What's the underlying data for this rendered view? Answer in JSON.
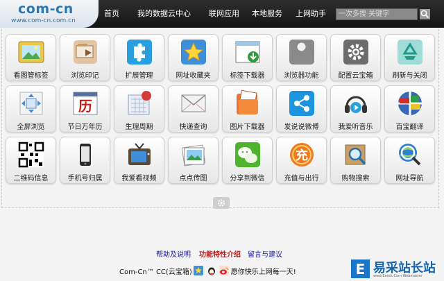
{
  "header": {
    "logo_main": "com-cn",
    "logo_sub": "www.com-cn.com.cn",
    "nav": [
      {
        "label": "首页",
        "name": "nav-home"
      },
      {
        "label": "我的数据云中心",
        "name": "nav-my-cloud-data"
      },
      {
        "label": "联网应用",
        "name": "nav-online-apps"
      },
      {
        "label": "本地服务",
        "name": "nav-local-services"
      },
      {
        "label": "上网助手",
        "name": "nav-web-assistant"
      }
    ],
    "search_placeholder": "一次多搜 关键字"
  },
  "tiles": [
    {
      "label": "看图管标签",
      "icon": "image-viewer-icon",
      "name": "tile-image-tag-manager"
    },
    {
      "label": "浏览印记",
      "icon": "browsing-history-icon",
      "name": "tile-browsing-footprint"
    },
    {
      "label": "扩展管理",
      "icon": "puzzle-extension-icon",
      "name": "tile-extension-manager"
    },
    {
      "label": "网址收藏夹",
      "icon": "star-favorites-icon",
      "name": "tile-url-favorites"
    },
    {
      "label": "标签下载器",
      "icon": "tab-download-icon",
      "name": "tile-tab-downloader"
    },
    {
      "label": "浏览器功能",
      "icon": "wrench-icon",
      "name": "tile-browser-features"
    },
    {
      "label": "配置云宝箱",
      "icon": "gear-icon",
      "name": "tile-configure-cloud-box"
    },
    {
      "label": "刷新与关闭",
      "icon": "recycle-refresh-icon",
      "name": "tile-refresh-close"
    },
    {
      "label": "全屏浏览",
      "icon": "fullscreen-arrows-icon",
      "name": "tile-fullscreen"
    },
    {
      "label": "节日万年历",
      "icon": "calendar-li-icon",
      "name": "tile-holiday-calendar"
    },
    {
      "label": "生理周期",
      "icon": "period-calendar-icon",
      "name": "tile-cycle-tracker"
    },
    {
      "label": "快递查询",
      "icon": "envelope-icon",
      "name": "tile-express-lookup"
    },
    {
      "label": "图片下载器",
      "icon": "picture-folder-icon",
      "name": "tile-image-downloader"
    },
    {
      "label": "发说说微博",
      "icon": "share-icon",
      "name": "tile-post-weibo"
    },
    {
      "label": "我爱听音乐",
      "icon": "headphones-music-icon",
      "name": "tile-music"
    },
    {
      "label": "百宝翻译",
      "icon": "flags-globe-icon",
      "name": "tile-translate"
    },
    {
      "label": "二维码信息",
      "icon": "qr-code-icon",
      "name": "tile-qr-code"
    },
    {
      "label": "手机号归属",
      "icon": "mobile-phone-icon",
      "name": "tile-phone-lookup"
    },
    {
      "label": "我爱看视频",
      "icon": "tv-icon",
      "name": "tile-video"
    },
    {
      "label": "点点传图",
      "icon": "photo-upload-icon",
      "name": "tile-photo-share"
    },
    {
      "label": "分享到微信",
      "icon": "wechat-icon",
      "name": "tile-share-wechat"
    },
    {
      "label": "充值与出行",
      "icon": "recharge-icon",
      "name": "tile-recharge-travel"
    },
    {
      "label": "购物搜索",
      "icon": "shopping-search-icon",
      "name": "tile-shopping-search"
    },
    {
      "label": "网址导航",
      "icon": "globe-search-icon",
      "name": "tile-url-navigation"
    }
  ],
  "links": [
    {
      "label": "帮助及说明",
      "color": "#1a1aa6",
      "name": "link-help"
    },
    {
      "label": "功能特性介绍",
      "color": "#c01818",
      "name": "link-features"
    },
    {
      "label": "留言与建议",
      "color": "#1a1aa6",
      "name": "link-feedback"
    }
  ],
  "footer": {
    "text_before": "Com-Cn™ CC(云宝箱)",
    "text_after": "愿你快乐上网每一天!"
  },
  "watermark": {
    "text": "易采站长站",
    "sub": "www.Easck.Com Webmaster",
    "color": "#1565b0"
  }
}
